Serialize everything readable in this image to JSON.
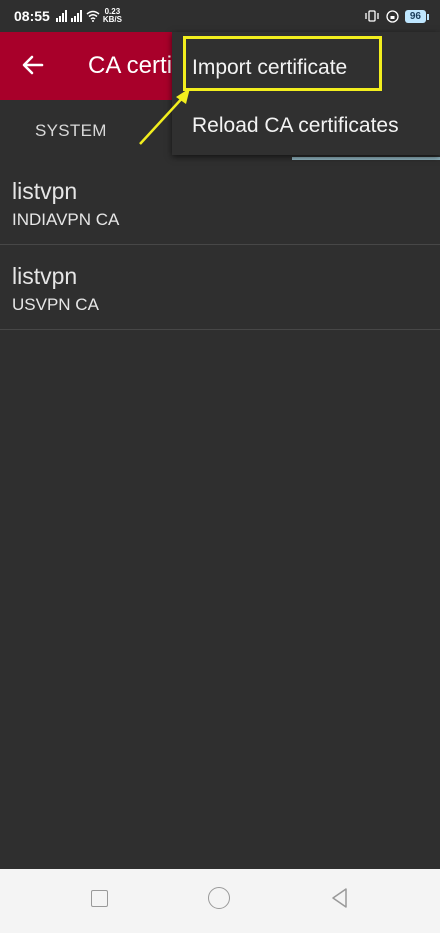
{
  "status": {
    "time": "08:55",
    "speed_value": "0.23",
    "speed_unit": "KB/S",
    "battery": "96"
  },
  "appbar": {
    "title": "CA certi"
  },
  "tabs": {
    "system_label": "SYSTEM"
  },
  "certificates": [
    {
      "name": "listvpn",
      "issuer": "INDIAVPN CA"
    },
    {
      "name": "listvpn",
      "issuer": "USVPN CA"
    }
  ],
  "menu": {
    "import_label": "Import certificate",
    "reload_label": "Reload CA certificates"
  },
  "colors": {
    "appbar": "#a8002a",
    "background": "#2f2f2f",
    "highlight": "#f2ee1e",
    "tab_indicator": "#8fb3bf"
  },
  "icons": [
    "back-arrow-icon",
    "signal-icon",
    "wifi-icon",
    "vibrate-icon",
    "alarm-icon",
    "battery-icon",
    "nav-recent-icon",
    "nav-home-icon",
    "nav-back-icon"
  ]
}
